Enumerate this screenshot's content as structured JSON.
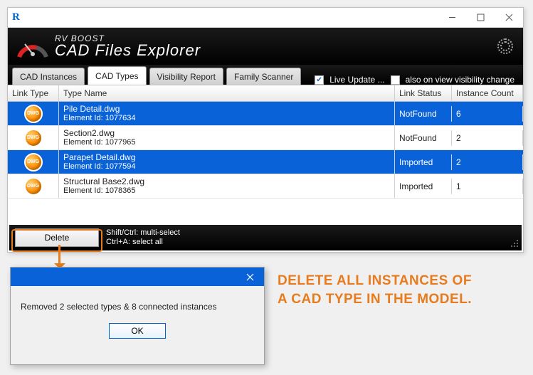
{
  "window": {
    "app_icon_text": "R"
  },
  "header": {
    "line1": "RV BOOST",
    "line2": "CAD Files Explorer"
  },
  "tabs": [
    {
      "label": "CAD Instances",
      "active": false
    },
    {
      "label": "CAD Types",
      "active": true
    },
    {
      "label": "Visibility Report",
      "active": false
    },
    {
      "label": "Family Scanner",
      "active": false
    }
  ],
  "tabbar_options": {
    "live_update": {
      "label": "Live Update ...",
      "checked": true
    },
    "also_on_view": {
      "label": "also on view visibility change",
      "checked": false
    }
  },
  "grid": {
    "columns": {
      "link_type": "Link Type",
      "type_name": "Type Name",
      "link_status": "Link Status",
      "instance_count": "Instance Count"
    },
    "rows": [
      {
        "filename": "Pile Detail.dwg",
        "element_id": "Element Id: 1077634",
        "status": "NotFound",
        "count": "6",
        "selected": true
      },
      {
        "filename": "Section2.dwg",
        "element_id": "Element Id: 1077965",
        "status": "NotFound",
        "count": "2",
        "selected": false
      },
      {
        "filename": "Parapet Detail.dwg",
        "element_id": "Element Id: 1077594",
        "status": "Imported",
        "count": "2",
        "selected": true
      },
      {
        "filename": "Structural Base2.dwg",
        "element_id": "Element Id: 1078365",
        "status": "Imported",
        "count": "1",
        "selected": false
      }
    ],
    "icon_label": "DWG"
  },
  "footer": {
    "delete_label": "Delete",
    "hint1": "Shift/Ctrl: multi-select",
    "hint2": "Ctrl+A: select all"
  },
  "dialog": {
    "message": "Removed 2 selected types & 8 connected instances",
    "ok_label": "OK"
  },
  "annotation": {
    "line1": "DELETE ALL INSTANCES OF",
    "line2": "A CAD TYPE IN THE MODEL."
  }
}
